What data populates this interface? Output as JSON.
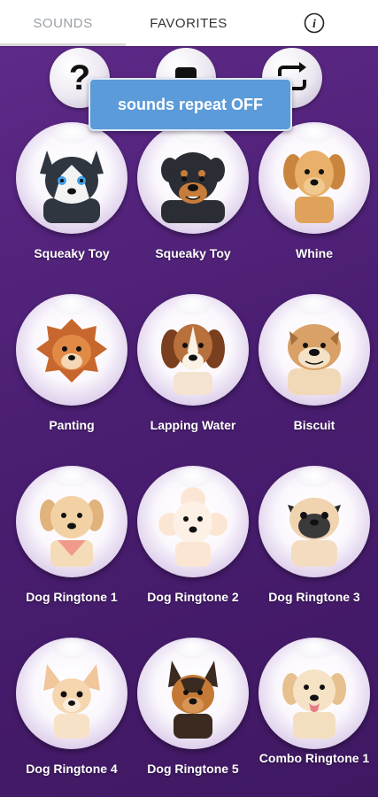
{
  "tabs": {
    "sounds": "SOUNDS",
    "favorites": "FAVORITES",
    "info_glyph": "i"
  },
  "controls": {
    "help_glyph": "?"
  },
  "toast": {
    "text": "sounds repeat OFF"
  },
  "sounds": [
    {
      "label": "Squeaky Toy",
      "icon": "husky-icon"
    },
    {
      "label": "Squeaky Toy",
      "icon": "rottweiler-icon"
    },
    {
      "label": "Whine",
      "icon": "golden-retriever-icon"
    },
    {
      "label": "Panting",
      "icon": "pomeranian-icon"
    },
    {
      "label": "Lapping Water",
      "icon": "beagle-icon"
    },
    {
      "label": "Biscuit",
      "icon": "bulldog-icon"
    },
    {
      "label": "Dog Ringtone 1",
      "icon": "labrador-bandana-icon"
    },
    {
      "label": "Dog Ringtone 2",
      "icon": "poodle-icon"
    },
    {
      "label": "Dog Ringtone 3",
      "icon": "pug-icon"
    },
    {
      "label": "Dog Ringtone 4",
      "icon": "chihuahua-icon"
    },
    {
      "label": "Dog Ringtone 5",
      "icon": "german-shepherd-icon"
    },
    {
      "label": "Combo Ringtone 1",
      "icon": "labrador-icon"
    }
  ],
  "colors": {
    "background": "#4a1e72",
    "toast": "#5b9bd9",
    "label": "#ffffff"
  }
}
